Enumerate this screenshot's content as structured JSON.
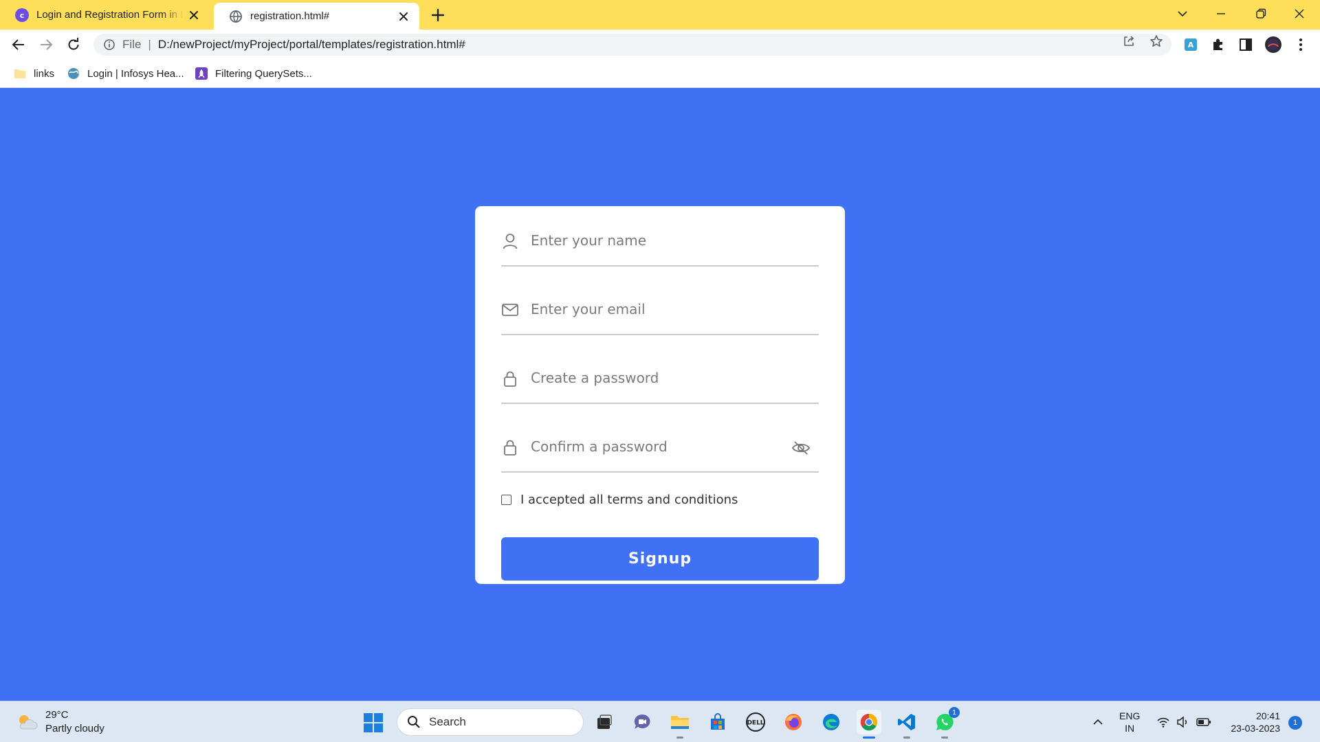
{
  "browser": {
    "tabs": [
      {
        "title": "Login and Registration Form in HTML",
        "favicon": "codinglab-icon",
        "active": false
      },
      {
        "title": "registration.html#",
        "favicon": "globe-icon",
        "active": true
      }
    ],
    "address": {
      "scheme": "File",
      "url": "D:/newProject/myProject/portal/templates/registration.html#"
    },
    "bookmarks": [
      {
        "label": "links",
        "icon": "folder-icon"
      },
      {
        "label": "Login | Infosys Hea...",
        "icon": "globe-icon"
      },
      {
        "label": "Filtering QuerySets...",
        "icon": "rocket-icon"
      }
    ]
  },
  "form": {
    "name_placeholder": "Enter your name",
    "email_placeholder": "Enter your email",
    "password_placeholder": "Create a password",
    "confirm_placeholder": "Confirm a password",
    "terms_label": "I accepted all terms and conditions",
    "signup_label": "Signup",
    "terms_checked": false
  },
  "taskbar": {
    "weather_temp": "29°C",
    "weather_desc": "Partly cloudy",
    "search_label": "Search",
    "lang_line1": "ENG",
    "lang_line2": "IN",
    "time": "20:41",
    "date": "23-03-2023",
    "notification_count": "1",
    "whatsapp_badge": "1"
  },
  "colors": {
    "page_background": "#4070f4",
    "accent": "#4070f4",
    "browser_frame": "#ffde59"
  }
}
